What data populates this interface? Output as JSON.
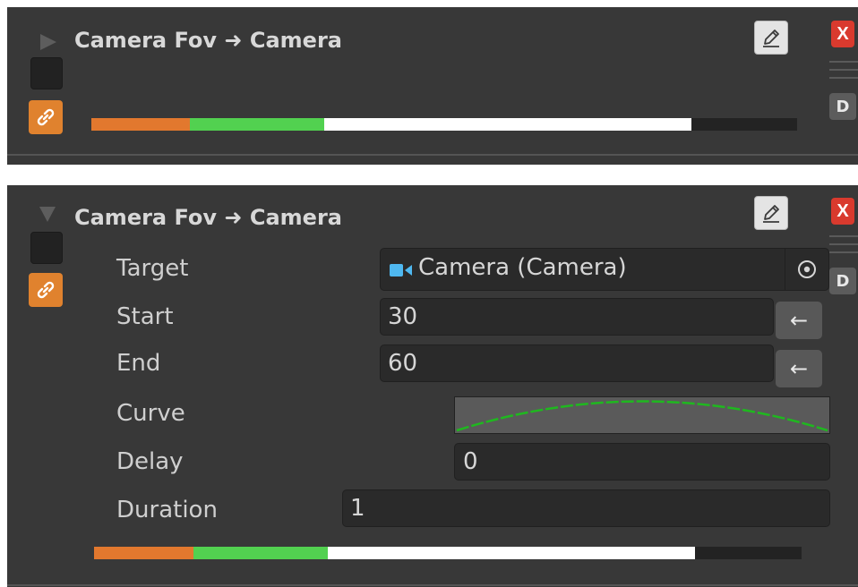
{
  "collapsed_panel": {
    "title": "Camera Fov ➜ Camera",
    "close_label": "X",
    "d_label": "D",
    "progress": {
      "delay": 0.14,
      "start": 0.19,
      "main": 0.52
    }
  },
  "expanded_panel": {
    "title": "Camera Fov ➜ Camera",
    "close_label": "X",
    "d_label": "D",
    "fields": {
      "target_label": "Target",
      "target_value": "Camera (Camera)",
      "start_label": "Start",
      "start_value": "30",
      "end_label": "End",
      "end_value": "60",
      "curve_label": "Curve",
      "delay_label": "Delay",
      "delay_value": "0",
      "duration_label": "Duration",
      "duration_value": "1"
    },
    "arrow_glyph": "←",
    "progress": {
      "delay": 0.14,
      "start": 0.19,
      "main": 0.52
    }
  },
  "colors": {
    "panel_bg": "#383838",
    "link_button": "#e0822e",
    "close_button": "#d93a2e",
    "delay_segment": "#e2782e",
    "start_segment": "#52d150",
    "main_segment": "#ffffff",
    "curve_line": "#1fb81f",
    "camera_icon": "#4fb8f0"
  },
  "icons": {
    "foldout_collapsed": "triangle-right-icon",
    "foldout_expanded": "triangle-down-icon",
    "link": "chain-link-icon",
    "edit": "pencil-icon",
    "drag": "drag-handle-icon",
    "camera": "camera-icon",
    "picker": "target-picker-icon"
  }
}
